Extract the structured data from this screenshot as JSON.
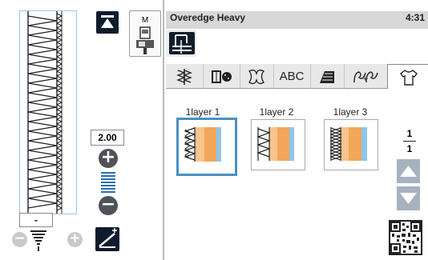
{
  "title": "Overedge Heavy",
  "clock": "4:31",
  "presser_foot": {
    "label": "M"
  },
  "width_value": "2.00",
  "length_value": "-",
  "tabs": [
    {
      "name": "utility-stitch-tab",
      "icon": "utility-stitch-icon"
    },
    {
      "name": "buttonhole-tab",
      "icon": "buttonhole-icon"
    },
    {
      "name": "decorative-stitch-tab",
      "icon": "decorative-stitch-icon"
    },
    {
      "name": "alphabet-tab",
      "label": "ABC"
    },
    {
      "name": "satin-stitch-tab",
      "icon": "satin-stitch-icon"
    },
    {
      "name": "cross-stitch-tab",
      "icon": "cross-stitch-icon"
    },
    {
      "name": "garment-tab",
      "icon": "shirt-icon"
    }
  ],
  "stitches": [
    {
      "label": "1layer 1"
    },
    {
      "label": "1layer 2"
    },
    {
      "label": "1layer 3"
    }
  ],
  "pager": {
    "current": "1",
    "total": "1"
  },
  "colors": {
    "accent": "#4a8fc5",
    "fabric": "#f2a65a",
    "dark": "#0f1c2d"
  }
}
